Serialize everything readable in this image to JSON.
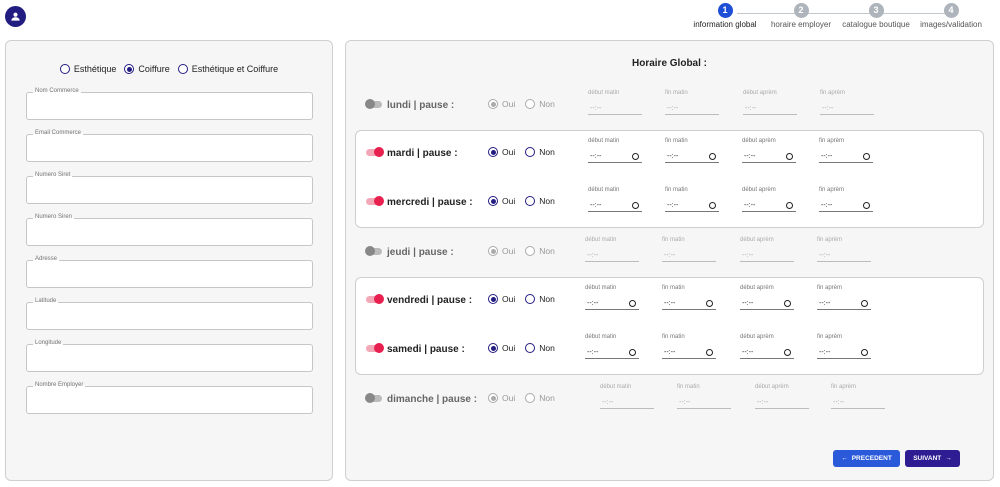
{
  "stepper": {
    "steps": [
      {
        "number": "1",
        "label": "information global",
        "active": true
      },
      {
        "number": "2",
        "label": "horaire employer",
        "active": false
      },
      {
        "number": "3",
        "label": "catalogue boutique",
        "active": false
      },
      {
        "number": "4",
        "label": "images/validation",
        "active": false
      }
    ]
  },
  "colors": {
    "primary": "#231d82",
    "step_active": "#1e4fd6",
    "step_inactive": "#aeb4bb",
    "toggle_on": "#e8204f",
    "prev_button": "#2a5ada",
    "next_button": "#2e1c93"
  },
  "business_type": {
    "options": [
      "Esthétique",
      "Coiffure",
      "Esthétique et Coiffure"
    ],
    "selected": "Coiffure"
  },
  "form": {
    "fields": [
      {
        "label": "Nom Commerce",
        "value": ""
      },
      {
        "label": "Email Commerce",
        "value": ""
      },
      {
        "label": "Numero Siret",
        "value": ""
      },
      {
        "label": "Numero Siren",
        "value": ""
      },
      {
        "label": "Adresse",
        "value": ""
      },
      {
        "label": "Latitude",
        "value": ""
      },
      {
        "label": "Longitude",
        "value": ""
      },
      {
        "label": "Nombre Employer",
        "value": ""
      }
    ]
  },
  "schedule": {
    "title": "Horaire Global :",
    "oui_label": "Oui",
    "non_label": "Non",
    "time_labels": [
      "début matin",
      "fin matin",
      "début aprèm",
      "fin aprèm"
    ],
    "time_placeholder": "--:--",
    "days": [
      {
        "label": "lundi | pause :",
        "enabled": false,
        "pause": "Oui"
      },
      {
        "label": "mardi | pause :",
        "enabled": true,
        "pause": "Oui"
      },
      {
        "label": "mercredi | pause :",
        "enabled": true,
        "pause": "Oui"
      },
      {
        "label": "jeudi | pause :",
        "enabled": false,
        "pause": "Oui"
      },
      {
        "label": "vendredi | pause :",
        "enabled": true,
        "pause": "Oui"
      },
      {
        "label": "samedi | pause :",
        "enabled": true,
        "pause": "Oui"
      },
      {
        "label": "dimanche | pause :",
        "enabled": false,
        "pause": "Oui"
      }
    ]
  },
  "buttons": {
    "prev_label": "PRECEDENT",
    "next_label": "SUIVANT"
  }
}
